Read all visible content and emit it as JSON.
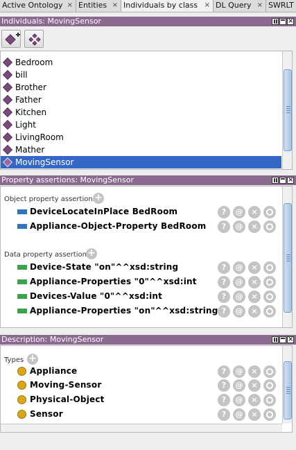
{
  "tabs": [
    {
      "label": "Active Ontology",
      "closable": true
    },
    {
      "label": "Entities",
      "closable": true
    },
    {
      "label": "Individuals by class",
      "closable": true,
      "active": true
    },
    {
      "label": "DL Query",
      "closable": true
    },
    {
      "label": "SWRLT",
      "closable": false
    }
  ],
  "close_glyph": "×",
  "individuals": {
    "header": "Individuals: MovingSensor",
    "items": [
      "Bedroom",
      "bill",
      "Brother",
      "Father",
      "Kitchen",
      "Light",
      "LivingRoom",
      "Mather",
      "MovingSensor"
    ],
    "selected": "MovingSensor"
  },
  "property_assertions": {
    "header": "Property assertions: MovingSensor",
    "object_label": "Object property assertions",
    "object_rows": [
      "DeviceLocateInPlace  BedRoom",
      "Appliance-Object-Property  BedRoom"
    ],
    "data_label": "Data property assertions",
    "data_rows": [
      "Device-State  \"on\"^^xsd:string",
      "Appliance-Properties  \"0\"^^xsd:int",
      "Devices-Value  \"0\"^^xsd:int",
      "Appliance-Properties  \"on\"^^xsd:string"
    ]
  },
  "description": {
    "header": "Description: MovingSensor",
    "types_label": "Types",
    "types": [
      "Appliance",
      "Moving-Sensor",
      "Physical-Object",
      "Sensor"
    ]
  },
  "row_buttons": {
    "help": "?",
    "annotate": "@",
    "delete": "×",
    "edit": ""
  },
  "colors": {
    "header": "#8a6a8f",
    "selection": "#3567c8",
    "object_property": "#2e74c0",
    "data_property": "#3aa44a",
    "class": "#d9a617",
    "individual": "#7b4a7e"
  },
  "icons": [
    "add-individual-icon",
    "delete-individual-icon",
    "add-icon",
    "help-icon",
    "annotate-icon",
    "delete-icon",
    "edit-icon"
  ]
}
